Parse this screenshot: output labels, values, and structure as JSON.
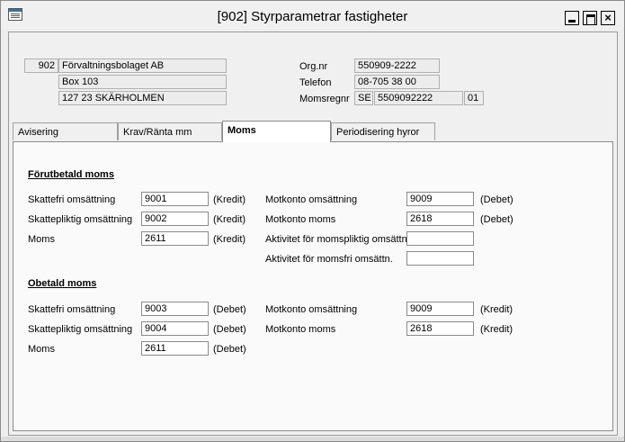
{
  "window": {
    "title": "[902]  Styrparametrar fastigheter"
  },
  "company": {
    "number": "902",
    "name": "Förvaltningsbolaget AB",
    "address": "Box 103",
    "postal": "127 23  SKÄRHOLMEN",
    "orgnr_label": "Org.nr",
    "orgnr": "550909-2222",
    "telefon_label": "Telefon",
    "telefon": "08-705 38 00",
    "momsregnr_label": "Momsregnr",
    "moms_country": "SE",
    "moms_number": "5509092222",
    "moms_suffix": "01"
  },
  "tabs": [
    {
      "label": "Avisering"
    },
    {
      "label": "Krav/Ränta mm"
    },
    {
      "label": "Moms"
    },
    {
      "label": "Periodisering hyror"
    }
  ],
  "prepaid": {
    "title": "Förutbetald moms",
    "rows": [
      {
        "label": "Skattefri omsättning",
        "value": "9001",
        "unit": "(Kredit)"
      },
      {
        "label": "Skattepliktig omsättning",
        "value": "9002",
        "unit": "(Kredit)"
      },
      {
        "label": "Moms",
        "value": "2611",
        "unit": "(Kredit)"
      }
    ],
    "right": [
      {
        "label": "Motkonto omsättning",
        "value": "9009",
        "unit": "(Debet)"
      },
      {
        "label": "Motkonto moms",
        "value": "2618",
        "unit": "(Debet)"
      },
      {
        "label": "Aktivitet för momspliktig omsättn.",
        "value": "",
        "unit": ""
      },
      {
        "label": "Aktivitet för momsfri omsättn.",
        "value": "",
        "unit": ""
      }
    ]
  },
  "unpaid": {
    "title": "Obetald moms",
    "rows": [
      {
        "label": "Skattefri omsättning",
        "value": "9003",
        "unit": "(Debet)"
      },
      {
        "label": "Skattepliktig omsättning",
        "value": "9004",
        "unit": "(Debet)"
      },
      {
        "label": "Moms",
        "value": "2611",
        "unit": "(Debet)"
      }
    ],
    "right": [
      {
        "label": "Motkonto omsättning",
        "value": "9009",
        "unit": "(Kredit)"
      },
      {
        "label": "Motkonto moms",
        "value": "2618",
        "unit": "(Kredit)"
      }
    ]
  }
}
